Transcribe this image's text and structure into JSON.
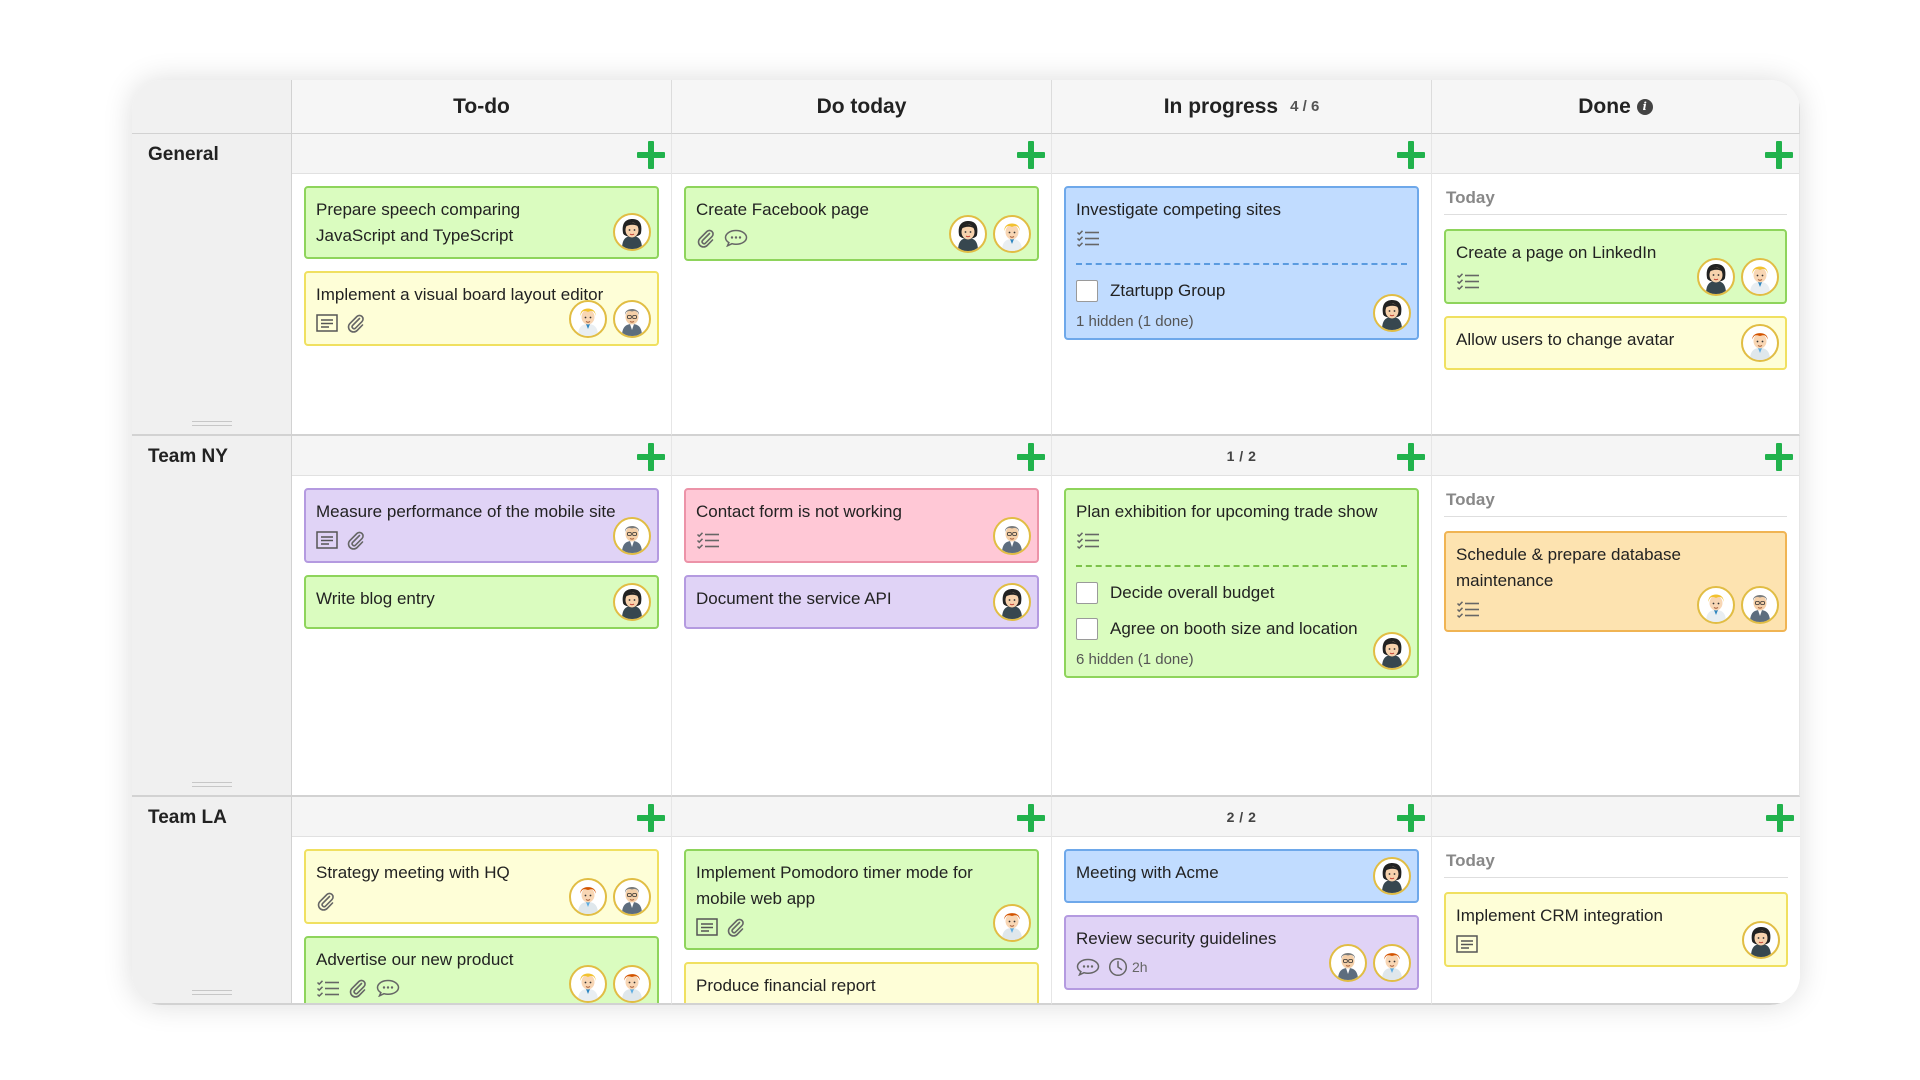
{
  "columns": [
    {
      "name": "To-do",
      "count": ""
    },
    {
      "name": "Do today",
      "count": ""
    },
    {
      "name": "In progress",
      "count": "4 / 6"
    },
    {
      "name": "Done",
      "count": ""
    }
  ],
  "lanes": [
    {
      "name": "General",
      "limits": [
        "",
        "",
        "",
        ""
      ],
      "done_label": "Today",
      "cells": [
        [
          {
            "title": "Prepare speech comparing JavaScript and TypeScript",
            "color": "green",
            "icons": [],
            "avatars": [
              "woman-dark-hair"
            ]
          },
          {
            "title": "Implement a visual board layout editor",
            "color": "yellow",
            "icons": [
              "description-icon",
              "attachment-icon"
            ],
            "avatars": [
              "man-blonde-hair",
              "man-grey-hair"
            ]
          }
        ],
        [
          {
            "title": "Create Facebook page",
            "color": "green",
            "icons": [
              "attachment-icon",
              "comment-icon"
            ],
            "avatars": [
              "woman-dark-hair",
              "man-blonde-hair"
            ]
          }
        ],
        [
          {
            "title": "Investigate competing sites",
            "color": "blue",
            "icons": [
              "checklist-icon"
            ],
            "avatars": [
              "woman-dark-hair"
            ],
            "checklist": [
              "Ztartupp Group"
            ],
            "hidden_note": "1 hidden (1 done)"
          }
        ],
        [
          {
            "title": "Create a page on LinkedIn",
            "color": "green",
            "icons": [
              "checklist-icon"
            ],
            "avatars": [
              "woman-dark-hair",
              "man-blonde-hair"
            ]
          },
          {
            "title": "Allow users to change avatar",
            "color": "yellow",
            "icons": [],
            "avatars": [
              "man-red-hair"
            ]
          }
        ]
      ]
    },
    {
      "name": "Team NY",
      "limits": [
        "",
        "",
        "1 / 2",
        ""
      ],
      "done_label": "Today",
      "cells": [
        [
          {
            "title": "Measure performance of the mobile site",
            "color": "purple",
            "icons": [
              "description-icon",
              "attachment-icon"
            ],
            "avatars": [
              "man-grey-hair"
            ]
          },
          {
            "title": "Write blog entry",
            "color": "green",
            "icons": [],
            "avatars": [
              "woman-dark-hair"
            ]
          }
        ],
        [
          {
            "title": "Contact form is not working",
            "color": "pink",
            "icons": [
              "checklist-icon"
            ],
            "avatars": [
              "man-grey-hair"
            ]
          },
          {
            "title": "Document the service API",
            "color": "purple",
            "icons": [],
            "avatars": [
              "woman-dark-hair"
            ]
          }
        ],
        [
          {
            "title": "Plan exhibition for upcoming trade show",
            "color": "green",
            "icons": [
              "checklist-icon"
            ],
            "avatars": [
              "woman-dark-hair"
            ],
            "checklist": [
              "Decide overall budget",
              "Agree on booth size and location"
            ],
            "hidden_note": "6 hidden (1 done)"
          }
        ],
        [
          {
            "title": "Schedule & prepare database maintenance",
            "color": "orange",
            "icons": [
              "checklist-icon"
            ],
            "avatars": [
              "man-blonde-hair",
              "man-grey-hair"
            ]
          }
        ]
      ]
    },
    {
      "name": "Team LA",
      "limits": [
        "",
        "",
        "2 / 2",
        ""
      ],
      "done_label": "Today",
      "cells": [
        [
          {
            "title": "Strategy meeting with HQ",
            "color": "yellow",
            "icons": [
              "attachment-icon"
            ],
            "avatars": [
              "man-red-hair",
              "man-grey-hair"
            ]
          },
          {
            "title": "Advertise our new product",
            "color": "green",
            "icons": [
              "checklist-icon",
              "attachment-icon",
              "comment-icon"
            ],
            "avatars": [
              "man-blonde-hair",
              "man-red-hair"
            ]
          }
        ],
        [
          {
            "title": "Implement Pomodoro timer mode for mobile web app",
            "color": "green",
            "icons": [
              "description-icon",
              "attachment-icon"
            ],
            "avatars": [
              "man-red-hair"
            ]
          },
          {
            "title": "Produce financial report",
            "color": "yellow",
            "icons": [],
            "avatars": []
          }
        ],
        [
          {
            "title": "Meeting with Acme",
            "color": "blue",
            "icons": [],
            "avatars": [
              "woman-dark-hair"
            ]
          },
          {
            "title": "Review security guidelines",
            "color": "purple",
            "icons": [
              "comment-icon",
              "clock-icon"
            ],
            "duration": "2h",
            "avatars": [
              "man-grey-hair",
              "man-red-hair"
            ]
          }
        ],
        [
          {
            "title": "Implement CRM integration",
            "color": "yellow",
            "icons": [
              "description-icon"
            ],
            "avatars": [
              "woman-dark-hair"
            ]
          }
        ]
      ]
    }
  ],
  "colors": {
    "add_button": "#21b24c",
    "green": "#dafcbf",
    "yellow": "#fefed7",
    "blue": "#c1dcff",
    "purple": "#e0d3f6",
    "pink": "#ffc8d6",
    "orange": "#fde3b0"
  }
}
